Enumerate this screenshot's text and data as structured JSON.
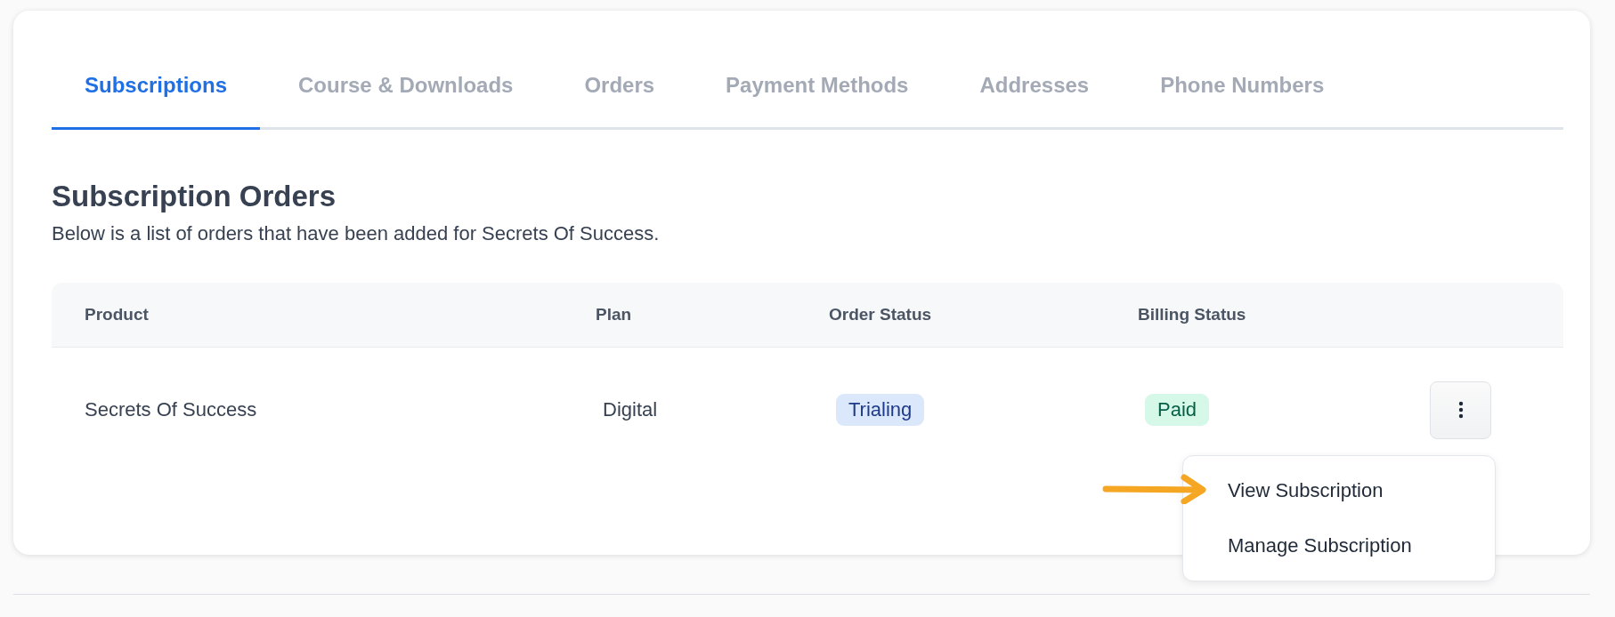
{
  "tabs": [
    {
      "label": "Subscriptions",
      "selected": true
    },
    {
      "label": "Course & Downloads",
      "selected": false
    },
    {
      "label": "Orders",
      "selected": false
    },
    {
      "label": "Payment Methods",
      "selected": false
    },
    {
      "label": "Addresses",
      "selected": false
    },
    {
      "label": "Phone Numbers",
      "selected": false
    }
  ],
  "heading": "Subscription Orders",
  "description": "Below is a list of orders that have been added for Secrets Of Success.",
  "table": {
    "columns": [
      "Product",
      "Plan",
      "Order Status",
      "Billing Status"
    ],
    "rows": [
      {
        "product": "Secrets Of Success",
        "plan": "Digital",
        "order_status": {
          "label": "Trialing",
          "kind": "info"
        },
        "billing_status": {
          "label": "Paid",
          "kind": "success"
        },
        "menu_open": true,
        "menu": [
          "View Subscription",
          "Manage Subscription"
        ]
      }
    ]
  }
}
